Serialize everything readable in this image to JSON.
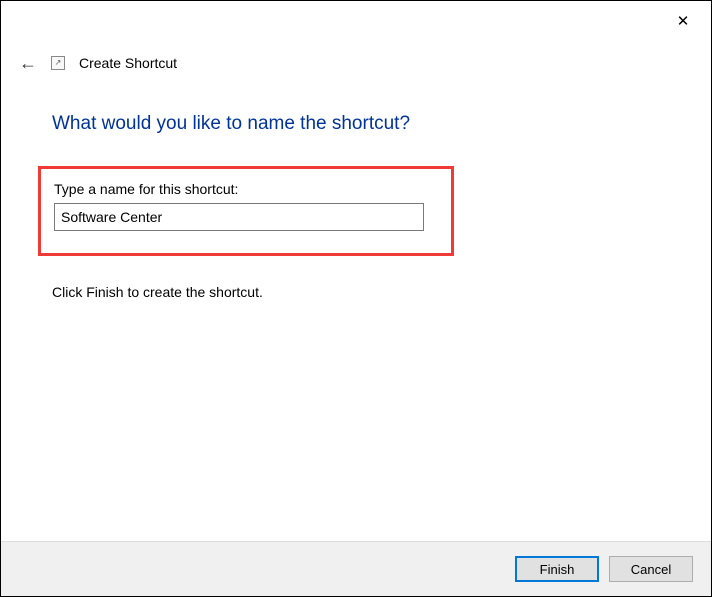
{
  "window": {
    "close_glyph": "✕"
  },
  "header": {
    "back_glyph": "←",
    "icon_glyph": "↗",
    "title": "Create Shortcut"
  },
  "main": {
    "heading": "What would you like to name the shortcut?",
    "field_label": "Type a name for this shortcut:",
    "input_value": "Software Center",
    "instruction": "Click Finish to create the shortcut."
  },
  "footer": {
    "finish_label": "Finish",
    "cancel_label": "Cancel"
  }
}
